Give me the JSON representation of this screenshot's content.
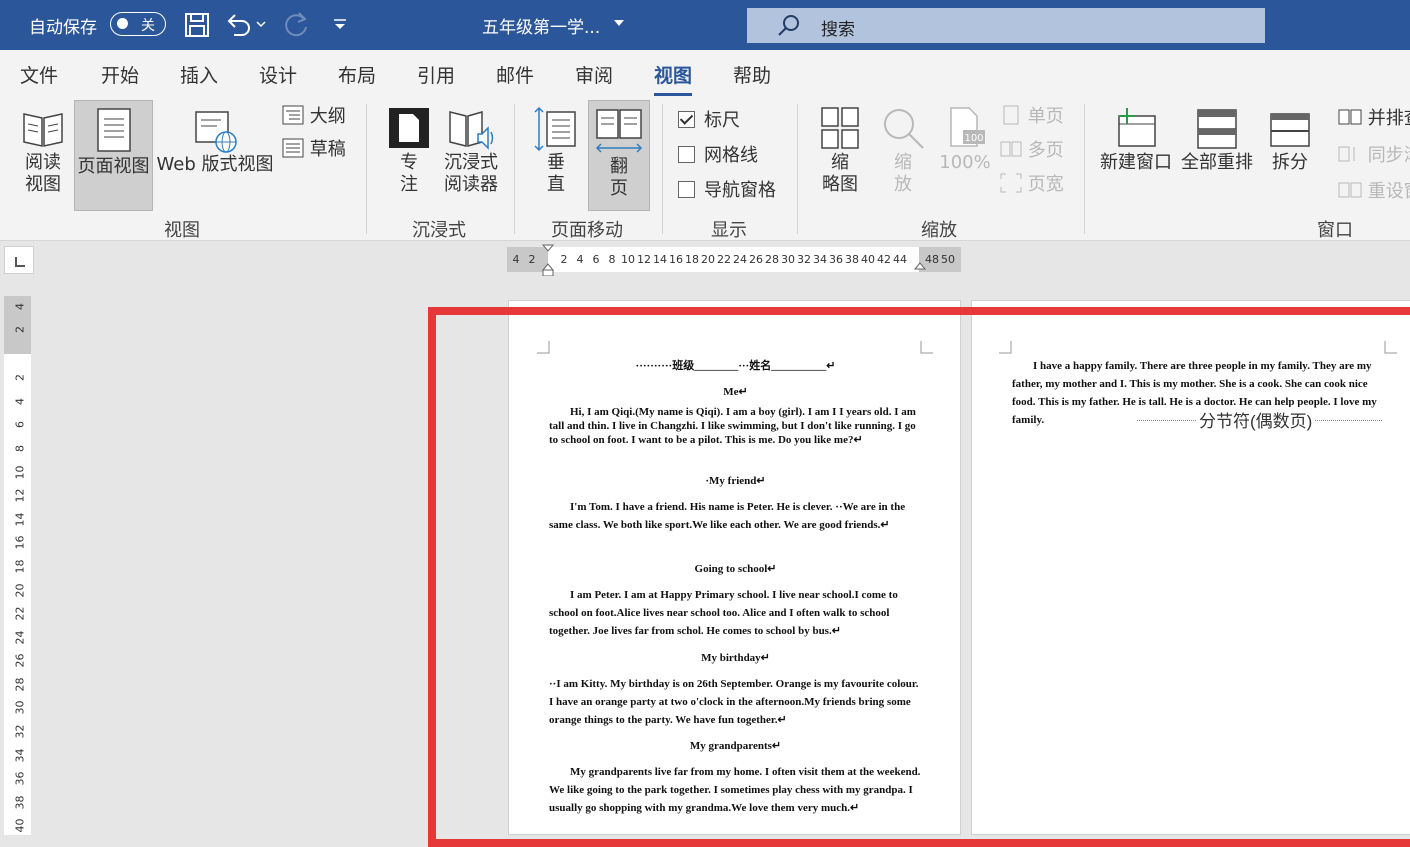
{
  "titlebar": {
    "autosave": "自动保存",
    "autosave_state": "关",
    "doc_title": "五年级第一学...",
    "search_placeholder": "搜索"
  },
  "menu": [
    "文件",
    "开始",
    "插入",
    "设计",
    "布局",
    "引用",
    "邮件",
    "审阅",
    "视图",
    "帮助"
  ],
  "menu_active": "视图",
  "ribbon": {
    "view": {
      "read": "阅读\n视图",
      "print": "页面视图",
      "web": "Web 版式视图",
      "outline": "大纲",
      "draft": "草稿",
      "label": "视图"
    },
    "immersive": {
      "focus": "专\n注",
      "reader": "沉浸式\n阅读器",
      "label": "沉浸式"
    },
    "pagemove": {
      "vertical": "垂\n直",
      "side": "翻\n页",
      "label": "页面移动"
    },
    "show": {
      "ruler": "标尺",
      "grid": "网格线",
      "nav": "导航窗格",
      "label": "显示"
    },
    "zoom": {
      "thumb": "缩\n略图",
      "zoom": "缩\n放",
      "pct": "100%",
      "one": "单页",
      "multi": "多页",
      "width": "页宽",
      "label": "缩放"
    },
    "window": {
      "new": "新建窗口",
      "arrange": "全部重排",
      "split": "拆分",
      "side": "并排查",
      "sync": "同步滚",
      "reset": "重设窗",
      "label": "窗口"
    }
  },
  "show_state": {
    "ruler": true,
    "grid": false,
    "nav": false
  },
  "hruler": [
    "4",
    "2",
    "2",
    "4",
    "6",
    "8",
    "10",
    "12",
    "14",
    "16",
    "18",
    "20",
    "22",
    "24",
    "26",
    "28",
    "30",
    "32",
    "34",
    "36",
    "38",
    "40",
    "42",
    "44",
    "48",
    "50"
  ],
  "vruler": [
    "4",
    "2",
    "2",
    "4",
    "6",
    "8",
    "10",
    "12",
    "14",
    "16",
    "18",
    "20",
    "22",
    "24",
    "26",
    "28",
    "30",
    "32",
    "34",
    "36",
    "38",
    "40"
  ],
  "page1": {
    "header": "··········班级________···姓名__________↵",
    "t1": "Me↵",
    "p1": "Hi, I am Qiqi.(My name is Qiqi). I am a boy (girl). I am I I years old. I am tall and thin. I live in Changzhi. I like swimming, but I don't like running. I go to school on foot. I want to be a pilot. This is me. Do you like me?↵",
    "t2": "·My friend↵",
    "p2": "I'm Tom. I have a friend. His name is Peter. He is clever. ··We are in the same class. We both like sport.We like each other. We are good friends.↵",
    "t3": "Going to school↵",
    "p3": "I am Peter. I am at Happy Primary school. I live near school.I come to school on foot.Alice lives near school too. Alice and I often walk to school together. Joe lives far from schol. He comes to school by bus.↵",
    "t4": "My birthday↵",
    "p4": "··I am Kitty. My birthday is on 26th September. Orange is my favourite colour. I have an orange party at two o'clock in the afternoon.My friends bring some orange things to the party. We have fun together.↵",
    "t5": "My grandparents↵",
    "p5": "My grandparents live far from my home. I often visit them at the weekend. We like going to the park together. I sometimes play chess with my grandpa. I usually go shopping with my grandma.We love them very much.↵"
  },
  "page2": {
    "p1": "I have a happy family. There are three people in my family. They are my father, my mother and I. This is my mother. She is a cook. She can cook nice food. This is my father. He is tall. He is a doctor. He can help people. I love my family.",
    "section_break": "分节符(偶数页)"
  },
  "colors": {
    "title_bar": "#2b579a",
    "highlight": "#e63838",
    "ribbon_bg": "#f3f3f3"
  }
}
